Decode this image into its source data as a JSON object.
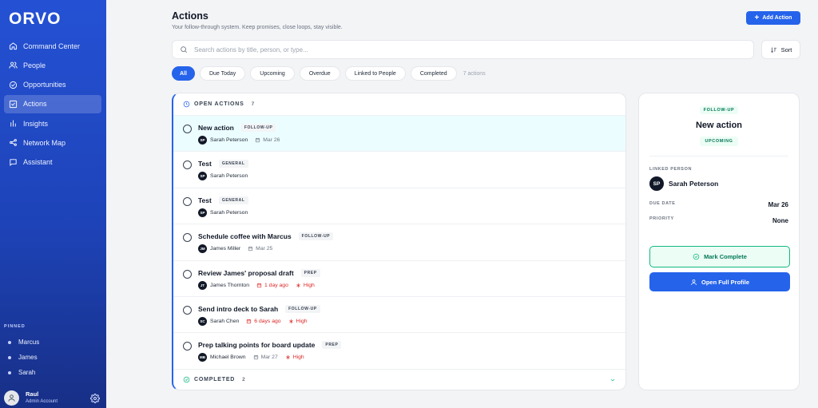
{
  "app": {
    "logo": "ORVO"
  },
  "colors": {
    "brand": "#2563eb",
    "success": "#10b981",
    "danger": "#dc2626"
  },
  "sidebar": {
    "items": [
      {
        "label": "Command Center",
        "icon": "home-icon",
        "active": false
      },
      {
        "label": "People",
        "icon": "people-icon",
        "active": false
      },
      {
        "label": "Opportunities",
        "icon": "target-icon",
        "active": false
      },
      {
        "label": "Actions",
        "icon": "checkbox-icon",
        "active": true
      },
      {
        "label": "Insights",
        "icon": "bar-chart-icon",
        "active": false
      },
      {
        "label": "Network Map",
        "icon": "network-icon",
        "active": false
      },
      {
        "label": "Assistant",
        "icon": "chat-icon",
        "active": false
      }
    ],
    "pinned_title": "PINNED",
    "pinned": [
      "Marcus",
      "James",
      "Sarah"
    ],
    "user": {
      "name": "Raul",
      "role": "Admin Account"
    }
  },
  "header": {
    "title": "Actions",
    "subtitle": "Your follow-through system. Keep promises, close loops, stay visible.",
    "add_label": "Add Action"
  },
  "search": {
    "placeholder": "Search actions by title, person, or type..."
  },
  "sort_label": "Sort",
  "filters": {
    "chips": [
      "All",
      "Due Today",
      "Upcoming",
      "Overdue",
      "Linked to People",
      "Completed"
    ],
    "active_index": 0,
    "count_label": "7 actions"
  },
  "open_section": {
    "title": "OPEN ACTIONS",
    "count": "7"
  },
  "actions": [
    {
      "title": "New action",
      "tag": "FOLLOW-UP",
      "initials": "SP",
      "person": "Sarah Peterson",
      "date": "Mar 26",
      "date_state": "normal",
      "priority": "",
      "selected": true
    },
    {
      "title": "Test",
      "tag": "GENERAL",
      "initials": "SP",
      "person": "Sarah Peterson",
      "date": "",
      "date_state": "normal",
      "priority": "",
      "selected": false
    },
    {
      "title": "Test",
      "tag": "GENERAL",
      "initials": "SP",
      "person": "Sarah Peterson",
      "date": "",
      "date_state": "normal",
      "priority": "",
      "selected": false
    },
    {
      "title": "Schedule coffee with Marcus",
      "tag": "FOLLOW-UP",
      "initials": "JM",
      "person": "James Miller",
      "date": "Mar 25",
      "date_state": "normal",
      "priority": "",
      "selected": false
    },
    {
      "title": "Review James' proposal draft",
      "tag": "PREP",
      "initials": "JT",
      "person": "James Thornton",
      "date": "1 day ago",
      "date_state": "overdue",
      "priority": "High",
      "selected": false
    },
    {
      "title": "Send intro deck to Sarah",
      "tag": "FOLLOW-UP",
      "initials": "SC",
      "person": "Sarah Chen",
      "date": "6 days ago",
      "date_state": "overdue",
      "priority": "High",
      "selected": false
    },
    {
      "title": "Prep talking points for board update",
      "tag": "PREP",
      "initials": "MB",
      "person": "Michael Brown",
      "date": "Mar 27",
      "date_state": "normal",
      "priority": "High",
      "selected": false
    }
  ],
  "completed_section": {
    "title": "COMPLETED",
    "count": "2"
  },
  "detail": {
    "tag": "FOLLOW-UP",
    "title": "New action",
    "status": "UPCOMING",
    "linked_label": "LINKED PERSON",
    "person_initials": "SP",
    "person_name": "Sarah Peterson",
    "due_label": "DUE DATE",
    "due_value": "Mar 26",
    "priority_label": "PRIORITY",
    "priority_value": "None",
    "mark_complete_label": "Mark Complete",
    "open_profile_label": "Open Full Profile"
  }
}
